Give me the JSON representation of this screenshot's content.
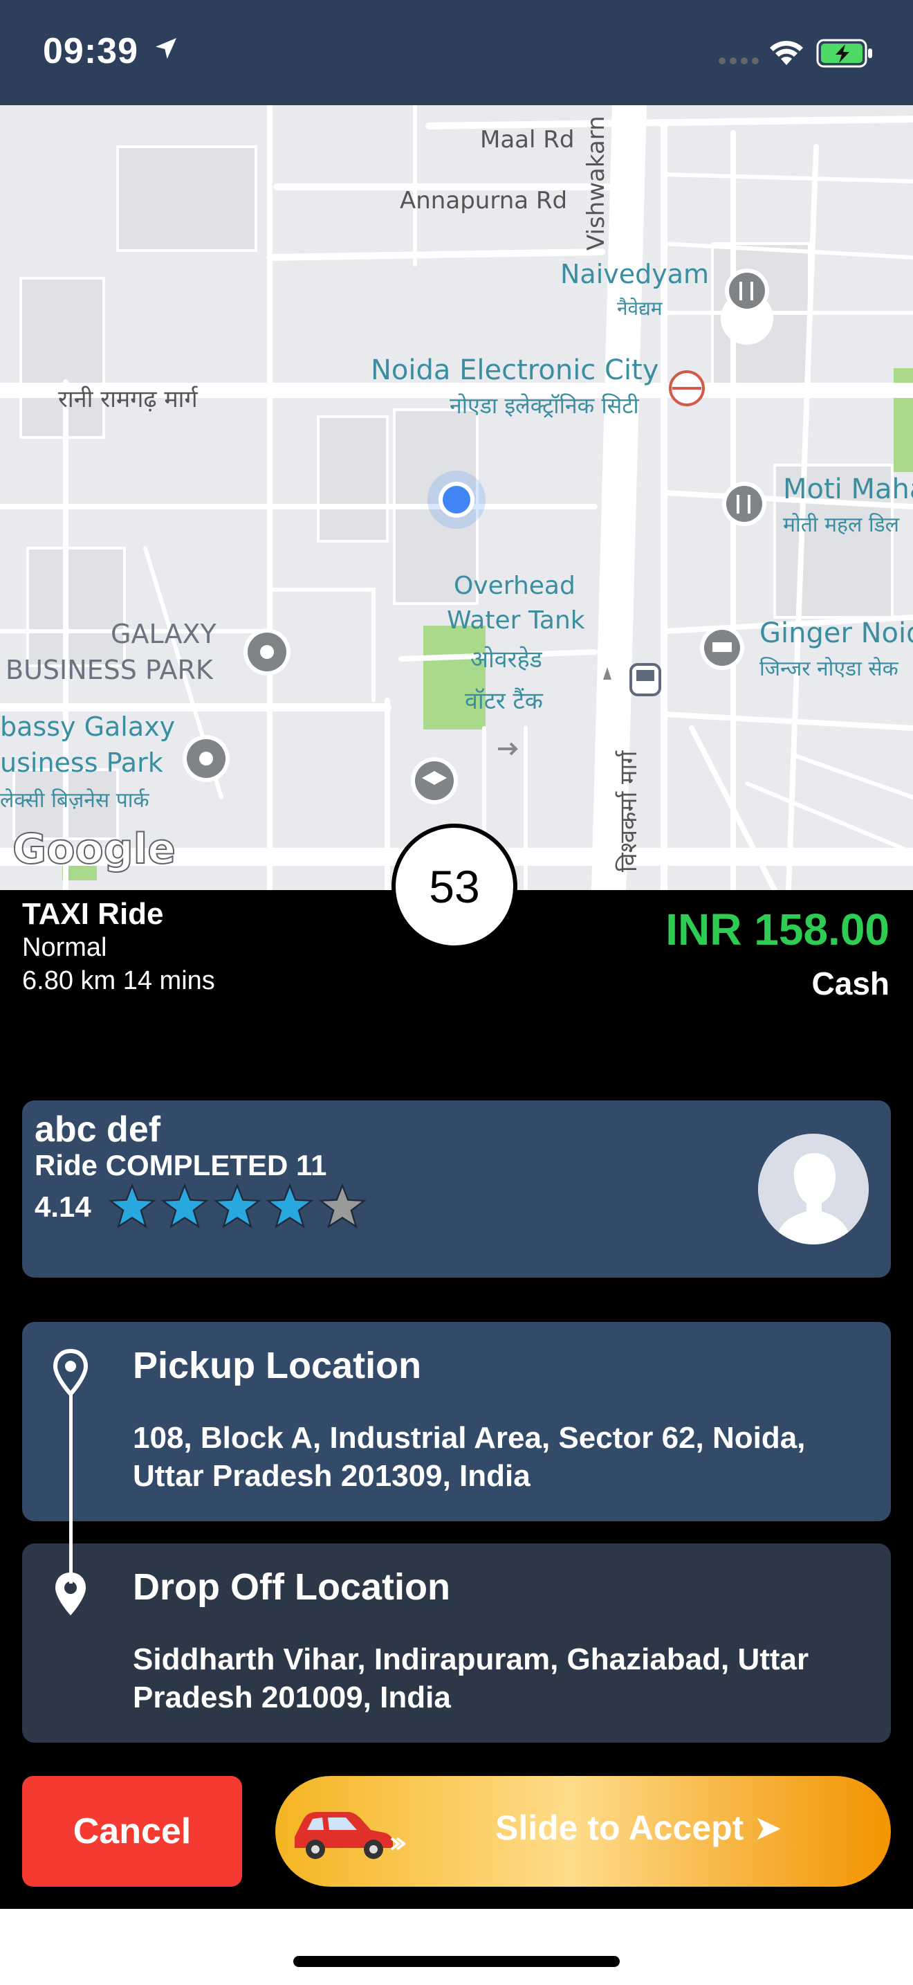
{
  "status_bar": {
    "time": "09:39"
  },
  "map": {
    "labels": {
      "maal_rd": "Maal Rd",
      "annapurna_rd": "Annapurna Rd",
      "vishwakarma": "Vishwakarn",
      "naivedyam": "Naivedyam",
      "naivedyam_hi": "नैवेद्यम",
      "rani_ramgarh": "रानी रामगढ़ मार्ग",
      "noida_ec": "Noida Electronic City",
      "noida_ec_hi": "नोएडा इलेक्ट्रॉनिक सिटी",
      "moti_mahal": "Moti Maha",
      "moti_mahal_hi": "मोती महल डिल",
      "overhead_tank_1": "Overhead",
      "overhead_tank_2": "Water Tank",
      "overhead_tank_hi_1": "ओवरहेड",
      "overhead_tank_hi_2": "वॉटर टैंक",
      "galaxy_bp_1": "GALAXY",
      "galaxy_bp_2": "BUSINESS PARK",
      "ginger": "Ginger Noid",
      "ginger_hi": "जिन्जर नोएडा सेक",
      "bassy_galaxy_1": "bassy Galaxy",
      "bassy_galaxy_2": "usiness Park",
      "bassy_galaxy_hi": "लेक्सी बिज़नेस पार्क",
      "vishwakarma_hi": "विश्वकर्मा मार्ग",
      "google": "Google"
    }
  },
  "counter": "53",
  "ride": {
    "type": "TAXI Ride",
    "class": "Normal",
    "meta": "6.80 km 14 mins",
    "price": "INR 158.00",
    "payment": "Cash"
  },
  "driver": {
    "name": "abc def",
    "rides_completed": "Ride COMPLETED 11",
    "rating_text": "4.14",
    "rating_value": 4.14,
    "rating_max": 5
  },
  "pickup": {
    "title": "Pickup Location",
    "address": "108, Block A, Industrial Area, Sector 62, Noida, Uttar Pradesh 201309, India"
  },
  "dropoff": {
    "title": "Drop Off Location",
    "address": "Siddharth Vihar, Indirapuram, Ghaziabad, Uttar Pradesh 201009, India"
  },
  "actions": {
    "cancel": "Cancel",
    "slide": "Slide to Accept ➤"
  },
  "colors": {
    "header": "#2e3f5c",
    "price": "#2ecc52",
    "card_primary": "#334a68",
    "card_secondary": "#2c3748",
    "cancel": "#f53a32",
    "star_filled": "#29a8e0",
    "star_empty": "#9a9a9a"
  }
}
